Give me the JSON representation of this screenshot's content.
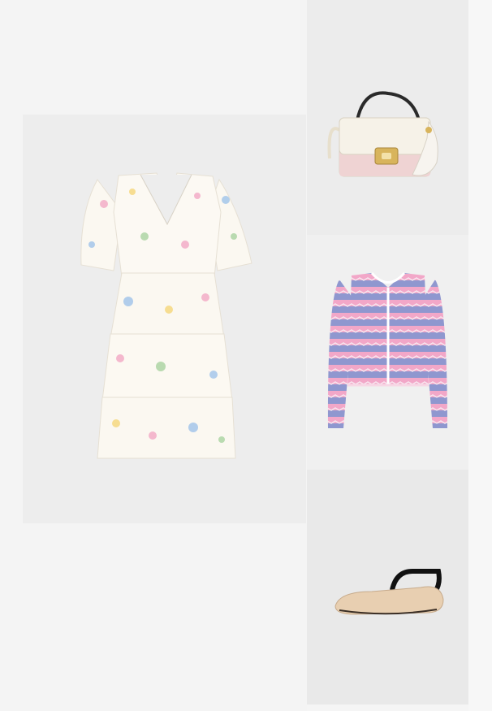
{
  "outfit": {
    "items": [
      {
        "id": "dress",
        "icon": "floral-tiered-dress-image"
      },
      {
        "id": "bag",
        "icon": "cream-top-handle-bag-image"
      },
      {
        "id": "cardigan",
        "icon": "striped-knit-cardigan-image"
      },
      {
        "id": "flats",
        "icon": "beige-ballet-flats-image"
      }
    ],
    "colors": {
      "background": "#f5f5f5",
      "tile_bg": "#ececec",
      "dress_base": "#fbf8f1",
      "cardigan_pink": "#f2a7c8",
      "cardigan_blue": "#8f97cf",
      "bag_cream": "#f3efe4",
      "bag_pink": "#efd3d3",
      "flats_beige": "#e8cfb1"
    }
  }
}
